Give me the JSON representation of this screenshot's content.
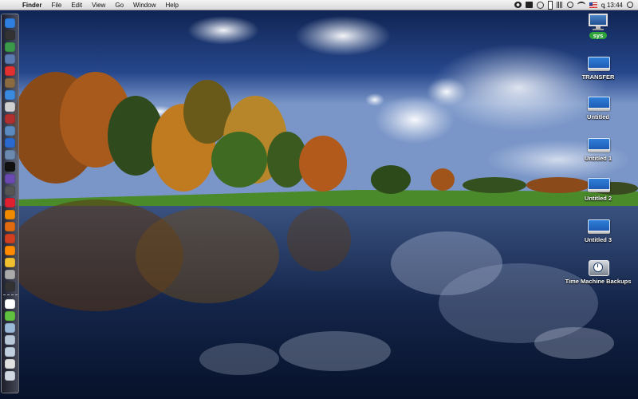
{
  "menubar": {
    "apple_icon": "apple-icon",
    "app_name": "Finder",
    "menus": [
      "File",
      "Edit",
      "View",
      "Go",
      "Window",
      "Help"
    ],
    "status_icons": [
      "gear-icon",
      "tool-icon",
      "time-machine-icon",
      "battery-icon",
      "volume-icon",
      "bluetooth-icon",
      "wifi-icon",
      "us-flag-icon",
      "spotlight-icon"
    ],
    "clock": "ꝗ 13:44"
  },
  "dock": {
    "items": [
      {
        "name": "finder",
        "color": "#2f7fe0"
      },
      {
        "name": "dashboard",
        "color": "#333333"
      },
      {
        "name": "globe",
        "color": "#3a9a4a"
      },
      {
        "name": "mail",
        "color": "#5a7ab0"
      },
      {
        "name": "ical",
        "color": "#e03030"
      },
      {
        "name": "address-book",
        "color": "#8a6a40"
      },
      {
        "name": "safari",
        "color": "#3a8ae0"
      },
      {
        "name": "mail-app",
        "color": "#d0d0d0"
      },
      {
        "name": "people",
        "color": "#b03030"
      },
      {
        "name": "iphoto",
        "color": "#5a8ac0"
      },
      {
        "name": "app-store",
        "color": "#2a6ad0"
      },
      {
        "name": "xcode",
        "color": "#6a8ab0"
      },
      {
        "name": "terminal",
        "color": "#111111"
      },
      {
        "name": "itunes",
        "color": "#6a4ab0"
      },
      {
        "name": "dvd-player",
        "color": "#555555"
      },
      {
        "name": "adium",
        "color": "#e02030"
      },
      {
        "name": "vlc",
        "color": "#f08a00"
      },
      {
        "name": "firefox",
        "color": "#e06a10"
      },
      {
        "name": "transmission",
        "color": "#d04020"
      },
      {
        "name": "vlc-cone",
        "color": "#ff8a00"
      },
      {
        "name": "growl",
        "color": "#f0c030"
      },
      {
        "name": "printer",
        "color": "#aaaaaa"
      },
      {
        "name": "calculator",
        "color": "#333333"
      }
    ],
    "stack_items": [
      {
        "name": "document",
        "color": "#ffffff"
      },
      {
        "name": "stickies",
        "color": "#60c040"
      },
      {
        "name": "folder-downloads",
        "color": "#9ab8d8"
      },
      {
        "name": "folder-docs",
        "color": "#b8c8d8"
      },
      {
        "name": "folder-apps",
        "color": "#c0d0e0"
      },
      {
        "name": "finder-window",
        "color": "#e0e0e0"
      },
      {
        "name": "trash",
        "color": "#cfd8e0"
      }
    ]
  },
  "desktop": {
    "icons": [
      {
        "name": "sys-volume",
        "label": "sys",
        "type": "monitor",
        "selected": true
      },
      {
        "name": "transfer-volume",
        "label": "TRANSFER",
        "type": "drive",
        "selected": false
      },
      {
        "name": "untitled-volume",
        "label": "Untitled",
        "type": "drive",
        "selected": false
      },
      {
        "name": "untitled-1-volume",
        "label": "Untitled 1",
        "type": "drive",
        "selected": false
      },
      {
        "name": "untitled-2-volume",
        "label": "Untitled 2",
        "type": "drive",
        "selected": false
      },
      {
        "name": "untitled-3-volume",
        "label": "Untitled 3",
        "type": "drive",
        "selected": false
      },
      {
        "name": "time-machine-backups",
        "label": "Time Machine Backups",
        "type": "timemachine",
        "selected": false
      }
    ]
  }
}
